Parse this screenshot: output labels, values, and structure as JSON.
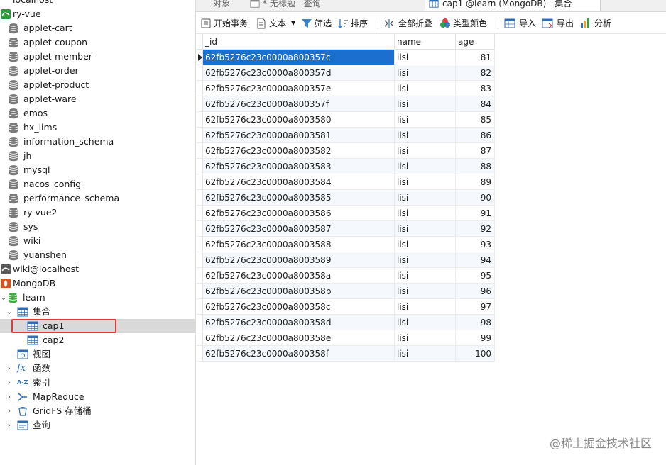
{
  "sidebar": {
    "top_partial": "localhost",
    "connection_ryvue": "ry-vue",
    "databases": [
      "applet-cart",
      "applet-coupon",
      "applet-member",
      "applet-order",
      "applet-product",
      "applet-ware",
      "emos",
      "hx_lims",
      "information_schema",
      "jh",
      "mysql",
      "nacos_config",
      "performance_schema",
      "ry-vue2",
      "sys",
      "wiki",
      "yuanshen"
    ],
    "connection_wiki": "wiki@localhost",
    "connection_mongo": "MongoDB",
    "db_learn": "learn",
    "collections_group": "集合",
    "collections": [
      "cap1",
      "cap2"
    ],
    "views": "视图",
    "functions": "函数",
    "indexes": "索引",
    "mapreduce": "MapReduce",
    "gridfs": "GridFS 存储桶",
    "queries": "查询"
  },
  "tabs": {
    "objects": "对象",
    "untitled_query": "* 无标题 - 查询",
    "active": "cap1 @learn (MongoDB) - 集合"
  },
  "toolbar": {
    "begin_transaction": "开始事务",
    "text": "文本",
    "filter": "筛选",
    "sort": "排序",
    "collapse_all": "全部折叠",
    "type_color": "类型颜色",
    "import": "导入",
    "export": "导出",
    "analyze": "分析"
  },
  "table": {
    "headers": [
      "_id",
      "name",
      "age"
    ],
    "rows": [
      [
        "62fb5276c23c0000a800357c",
        "lisi",
        "81"
      ],
      [
        "62fb5276c23c0000a800357d",
        "lisi",
        "82"
      ],
      [
        "62fb5276c23c0000a800357e",
        "lisi",
        "83"
      ],
      [
        "62fb5276c23c0000a800357f",
        "lisi",
        "84"
      ],
      [
        "62fb5276c23c0000a8003580",
        "lisi",
        "85"
      ],
      [
        "62fb5276c23c0000a8003581",
        "lisi",
        "86"
      ],
      [
        "62fb5276c23c0000a8003582",
        "lisi",
        "87"
      ],
      [
        "62fb5276c23c0000a8003583",
        "lisi",
        "88"
      ],
      [
        "62fb5276c23c0000a8003584",
        "lisi",
        "89"
      ],
      [
        "62fb5276c23c0000a8003585",
        "lisi",
        "90"
      ],
      [
        "62fb5276c23c0000a8003586",
        "lisi",
        "91"
      ],
      [
        "62fb5276c23c0000a8003587",
        "lisi",
        "92"
      ],
      [
        "62fb5276c23c0000a8003588",
        "lisi",
        "93"
      ],
      [
        "62fb5276c23c0000a8003589",
        "lisi",
        "94"
      ],
      [
        "62fb5276c23c0000a800358a",
        "lisi",
        "95"
      ],
      [
        "62fb5276c23c0000a800358b",
        "lisi",
        "96"
      ],
      [
        "62fb5276c23c0000a800358c",
        "lisi",
        "97"
      ],
      [
        "62fb5276c23c0000a800358d",
        "lisi",
        "98"
      ],
      [
        "62fb5276c23c0000a800358e",
        "lisi",
        "99"
      ],
      [
        "62fb5276c23c0000a800358f",
        "lisi",
        "100"
      ]
    ]
  },
  "watermark": "@稀土掘金技术社区",
  "colors": {
    "selection": "#1a6fcf",
    "highlight_box": "#e03a3a",
    "db_green": "#3fae3f"
  }
}
